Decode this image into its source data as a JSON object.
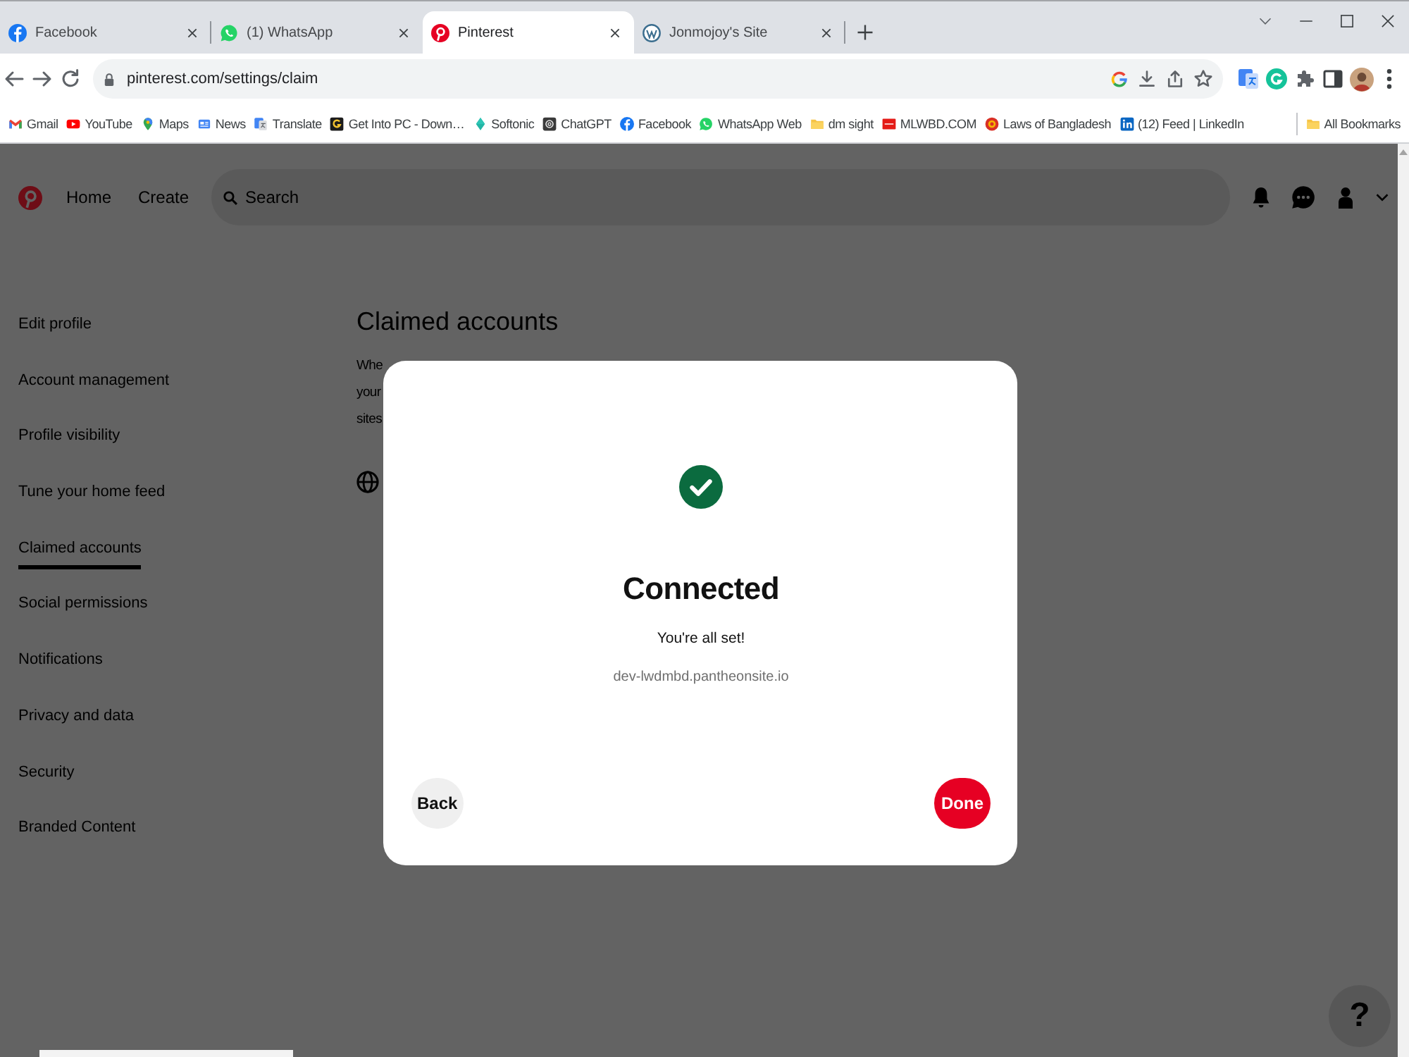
{
  "browser": {
    "tabs": [
      {
        "kind": "flogo",
        "title": "Facebook",
        "selected": false
      },
      {
        "kind": "chat",
        "title": "(1) WhatsApp",
        "selected": false
      },
      {
        "kind": "pinlogo",
        "title": "Pinterest",
        "selected": true
      },
      {
        "kind": "wlogo",
        "title": "Jonmojoy's Site",
        "selected": false
      }
    ],
    "url": "pinterest.com/settings/claim",
    "bookmarks": [
      {
        "kind": "envelope",
        "label": "Gmail"
      },
      {
        "kind": "play",
        "label": "YouTube"
      },
      {
        "kind": "mappin",
        "label": "Maps"
      },
      {
        "kind": "newspaper",
        "label": "News"
      },
      {
        "kind": "translate",
        "label": "Translate"
      },
      {
        "kind": "gtile",
        "label": "Get Into PC - Down…"
      },
      {
        "kind": "diamond",
        "label": "Softonic"
      },
      {
        "kind": "ringtile",
        "label": "ChatGPT"
      },
      {
        "kind": "flogo",
        "label": "Facebook"
      },
      {
        "kind": "chat",
        "label": "WhatsApp Web"
      },
      {
        "kind": "folder",
        "label": "dm sight"
      },
      {
        "kind": "redtile",
        "label": "MLWBD.COM"
      },
      {
        "kind": "seal",
        "label": "Laws of Bangladesh"
      },
      {
        "kind": "squarelogo",
        "label": "(12) Feed | LinkedIn"
      }
    ],
    "all_bookmarks": "All Bookmarks"
  },
  "header": {
    "nav": [
      "Home",
      "Create"
    ],
    "search": {
      "placeholder": "Search"
    }
  },
  "sidebar": {
    "items": [
      {
        "label": "Edit profile",
        "selected": false
      },
      {
        "label": "Account management",
        "selected": false
      },
      {
        "label": "Profile visibility",
        "selected": false
      },
      {
        "label": "Tune your home feed",
        "selected": false
      },
      {
        "label": "Claimed accounts",
        "selected": true
      },
      {
        "label": "Social permissions",
        "selected": false
      },
      {
        "label": "Notifications",
        "selected": false
      },
      {
        "label": "Privacy and data",
        "selected": false
      },
      {
        "label": "Security",
        "selected": false
      },
      {
        "label": "Branded Content",
        "selected": false
      }
    ]
  },
  "content": {
    "title": "Claimed accounts",
    "description_lines": [
      "Whe",
      "your",
      "sites"
    ]
  },
  "dialog": {
    "title": "Connected",
    "message": "You're all set!",
    "site": "dev-lwdmbd.pantheonsite.io",
    "buttons": [
      {
        "kind": "secondary",
        "label": "Back"
      },
      {
        "kind": "primary",
        "label": "Done"
      }
    ]
  },
  "help_button": "?"
}
